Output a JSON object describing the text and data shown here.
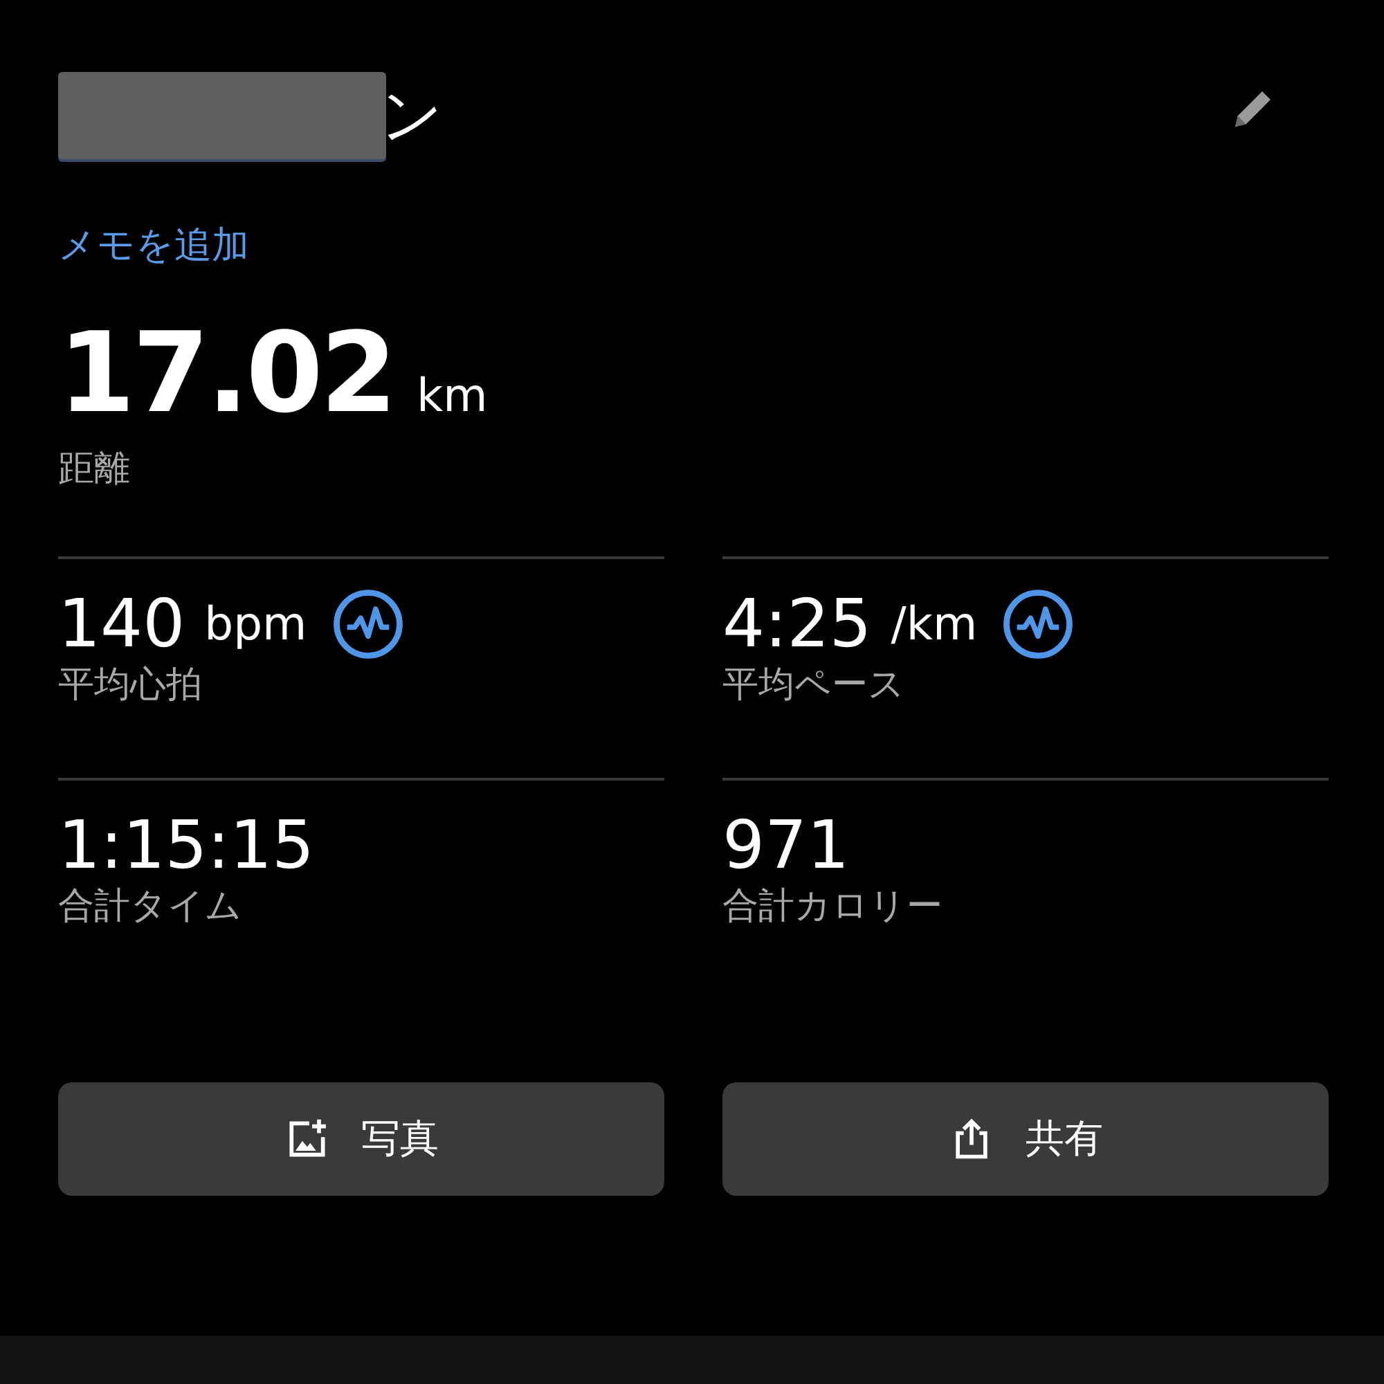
{
  "header": {
    "title_visible": "ン",
    "redacted": true
  },
  "memo_link": "メモを追加",
  "distance": {
    "value": "17.02",
    "unit": "km",
    "label": "距離"
  },
  "stats": [
    {
      "value": "140",
      "unit": "bpm",
      "label": "平均心拍",
      "chart_icon": true
    },
    {
      "value": "4:25",
      "unit": "/km",
      "label": "平均ペース",
      "chart_icon": true
    },
    {
      "value": "1:15:15",
      "label": "合計タイム",
      "chart_icon": false
    },
    {
      "value": "971",
      "label": "合計カロリー",
      "chart_icon": false
    }
  ],
  "buttons": [
    {
      "kind": "photo",
      "label": "写真"
    },
    {
      "kind": "share",
      "label": "共有"
    }
  ]
}
